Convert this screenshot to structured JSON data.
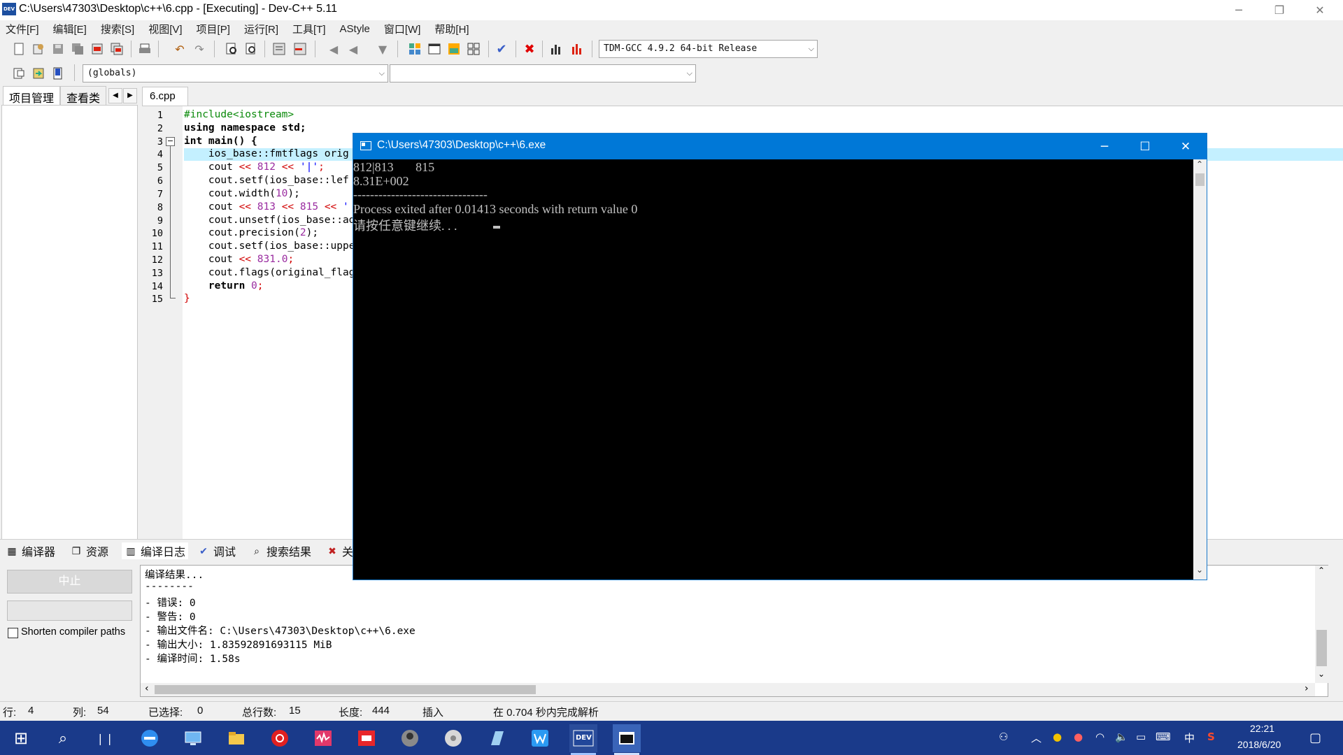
{
  "window": {
    "title": "C:\\Users\\47303\\Desktop\\c++\\6.cpp - [Executing] - Dev-C++ 5.11",
    "app_icon_text": "DEV",
    "min_glyph": "─",
    "restore_glyph": "❐",
    "close_glyph": "✕"
  },
  "menu": [
    "文件[F]",
    "编辑[E]",
    "搜索[S]",
    "视图[V]",
    "项目[P]",
    "运行[R]",
    "工具[T]",
    "AStyle",
    "窗口[W]",
    "帮助[H]"
  ],
  "toolbar": {
    "compiler_select": "TDM-GCC 4.9.2 64-bit Release",
    "scope_select": "(globals)",
    "function_select": "",
    "dropdown_arrow": "⌵"
  },
  "left_panel": {
    "tabs": [
      "项目管理",
      "查看类"
    ],
    "nav_prev": "◀",
    "nav_next": "▶"
  },
  "editor": {
    "tab": "6.cpp",
    "fold_marker": "−",
    "line_numbers": [
      "1",
      "2",
      "3",
      "4",
      "5",
      "6",
      "7",
      "8",
      "9",
      "10",
      "11",
      "12",
      "13",
      "14",
      "15"
    ],
    "code": {
      "l1_pp": "#include<iostream>",
      "l2_kw": "using namespace",
      "l2_rest": " std;",
      "l3_kw": "int",
      "l3_rest": " main() {",
      "l4": "    ios_base::fmtflags orig",
      "l5_a": "    cout ",
      "l5_op1": "<<",
      "l5_num": " 812 ",
      "l5_op2": "<<",
      "l5_str": " '|'",
      "l5_end": ";",
      "l6": "    cout.setf(ios_base::lef",
      "l7_a": "    cout.width(",
      "l7_num": "10",
      "l7_end": ");",
      "l8_a": "    cout ",
      "l8_op1": "<<",
      "l8_num1": " 813 ",
      "l8_op2": "<<",
      "l8_num2": " 815 ",
      "l8_op3": "<<",
      "l8_str": " '",
      "l9": "    cout.unsetf(ios_base::ad",
      "l10_a": "    cout.precision(",
      "l10_num": "2",
      "l10_end": ");",
      "l11": "    cout.setf(ios_base::uppe",
      "l12_a": "    cout ",
      "l12_op": "<<",
      "l12_num": " 831.0",
      "l12_end": ";",
      "l13": "    cout.flags(original_flag",
      "l14_kw": "    return",
      "l14_num": " 0",
      "l14_end": ";",
      "l15": "}"
    }
  },
  "console": {
    "title": "C:\\Users\\47303\\Desktop\\c++\\6.exe",
    "lines": [
      "812|813       815",
      "8.31E+002",
      "--------------------------------",
      "Process exited after 0.01413 seconds with return value 0",
      "请按任意键继续. . ."
    ],
    "min_glyph": "─",
    "max_glyph": "☐",
    "close_glyph": "✕",
    "scroll_up": "⌃",
    "scroll_down": "⌄"
  },
  "bottom_tabs": [
    {
      "label": "编译器",
      "icon": "▦"
    },
    {
      "label": "资源",
      "icon": "❐"
    },
    {
      "label": "编译日志",
      "icon": "▥"
    },
    {
      "label": "调试",
      "icon": "✔"
    },
    {
      "label": "搜索结果",
      "icon": "⌕"
    },
    {
      "label": "关",
      "icon": "✖"
    }
  ],
  "bottom_panel": {
    "abort_button": "中止",
    "shorten_label": "Shorten compiler paths",
    "log_lines": [
      "编译结果...",
      "--------",
      "- 错误: 0",
      "- 警告: 0",
      "- 输出文件名: C:\\Users\\47303\\Desktop\\c++\\6.exe",
      "- 输出大小: 1.83592891693115 MiB",
      "- 编译时间: 1.58s"
    ],
    "scroll_up": "⌃",
    "scroll_down": "⌄",
    "scroll_left": "‹",
    "scroll_right": "›"
  },
  "status": {
    "row_label": "行:",
    "row_value": "4",
    "col_label": "列:",
    "col_value": "54",
    "sel_label": "已选择:",
    "sel_value": "0",
    "lines_label": "总行数:",
    "lines_value": "15",
    "len_label": "长度:",
    "len_value": "444",
    "mode": "插入",
    "parse": "在 0.704 秒内完成解析"
  },
  "taskbar": {
    "start": "⊞",
    "search": "⌕",
    "taskview": "❘❘",
    "apps": [
      "edge-icon",
      "computer-icon",
      "folder-icon",
      "netease-music-icon",
      "audio-editor-icon",
      "youdao-icon",
      "avatar-icon",
      "disc-icon",
      "notes-icon",
      "word-icon",
      "devcpp-icon",
      "console-icon"
    ],
    "tray": {
      "people": "⚇",
      "chevron": "︿",
      "qq1": "●",
      "qq2": "●",
      "wifi": "◠",
      "volume": "🔈",
      "battery": "▭",
      "keyboard": "⌨",
      "ime": "中",
      "sogou": "S",
      "time": "22:21",
      "date": "2018/6/20",
      "notify": "▢"
    }
  },
  "colors": {
    "console_title": "#0078d7",
    "taskbar": "#1a3a8a",
    "current_line": "#c4f0ff"
  }
}
